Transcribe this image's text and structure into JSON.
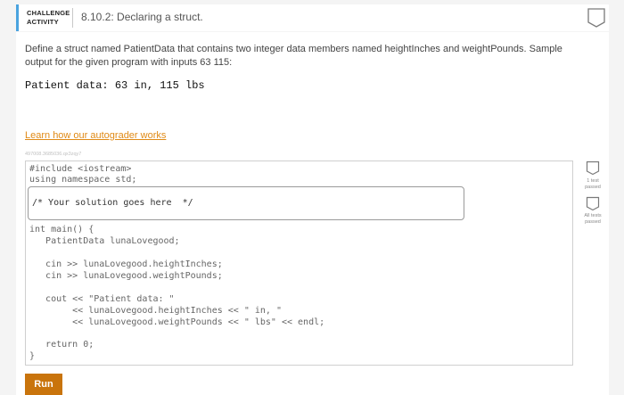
{
  "header": {
    "challenge_line1": "CHALLENGE",
    "challenge_line2": "ACTIVITY",
    "title": "8.10.2: Declaring a struct."
  },
  "content": {
    "description": "Define a struct named PatientData that contains two integer data members named heightInches and weightPounds. Sample output for the given program with inputs 63 115:",
    "sample_output": "Patient data: 63 in, 115 lbs",
    "learn_link": "Learn how our autograder works",
    "code_id": "497008.3685036.qx3zqy7"
  },
  "editor": {
    "line1": "#include <iostream>",
    "line2": "using namespace std;",
    "solution_placeholder": "/* Your solution goes here  */",
    "line4": "int main() {",
    "line5": "   PatientData lunaLovegood;",
    "line6": "   cin >> lunaLovegood.heightInches;",
    "line7": "   cin >> lunaLovegood.weightPounds;",
    "line8": "   cout << \"Patient data: \"",
    "line9": "        << lunaLovegood.heightInches << \" in, \"",
    "line10": "        << lunaLovegood.weightPounds << \" lbs\" << endl;",
    "line11": "   return 0;",
    "line12": "}"
  },
  "run_button": "Run",
  "tests": {
    "test1_line1": "1 test",
    "test1_line2": "passed",
    "all_line1": "All tests",
    "all_line2": "passed"
  },
  "colors": {
    "accent": "#4aa3df",
    "run_button": "#c9740c",
    "link": "#e08a16"
  }
}
